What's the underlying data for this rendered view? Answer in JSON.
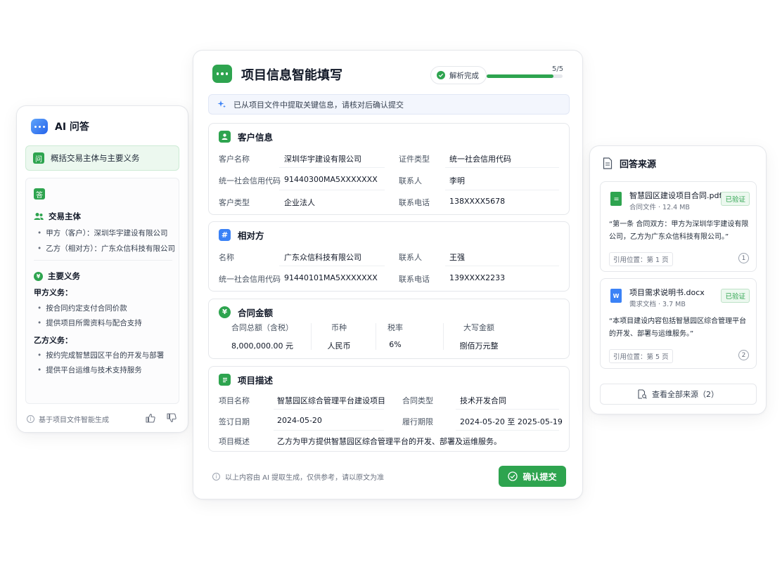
{
  "left": {
    "title": "AI 问答",
    "question_tag": "问",
    "question": "概括交易主体与主要义务",
    "answer_tag": "答",
    "parties_title": "交易主体",
    "parties": [
      "甲方（客户）：深圳华宇建设有限公司",
      "乙方（相对方）：广东众信科技有限公司"
    ],
    "obligations_title": "主要义务",
    "party_a_title": "甲方义务：",
    "party_a_items": [
      "按合同约定支付合同价款",
      "提供项目所需资料与配合支持"
    ],
    "party_b_title": "乙方义务：",
    "party_b_items": [
      "按约完成智慧园区平台的开发与部署",
      "提供平台运维与技术支持服务"
    ],
    "footer": "基于项目文件智能生成"
  },
  "center": {
    "title": "项目信息智能填写",
    "status": "解析完成",
    "progress_text": "5/5",
    "progress_fraction": 0.88,
    "notice": "已从项目文件中提取关键信息，请核对后确认提交",
    "customer": {
      "title": "客户信息",
      "name_label": "客户名称",
      "name_value": "深圳华宇建设有限公司",
      "cert_type_label": "证件类型",
      "cert_type_value": "统一社会信用代码",
      "credit_label": "统一社会信用代码",
      "credit_value": "91440300MA5XXXXXXX",
      "contact_label": "联系人",
      "contact_value": "李明",
      "type_label": "客户类型",
      "type_value": "企业法人",
      "phone_label": "联系电话",
      "phone_value": "138XXXX5678"
    },
    "counterparty": {
      "title": "相对方",
      "name_label": "名称",
      "name_value": "广东众信科技有限公司",
      "contact_label": "联系人",
      "contact_value": "王强",
      "credit_label": "统一社会信用代码",
      "credit_value": "91440101MA5XXXXXXX",
      "phone_label": "联系电话",
      "phone_value": "139XXXX2233"
    },
    "amount": {
      "title": "合同金额",
      "total_label": "合同总额（含税）",
      "total_value": "8,000,000.00 元",
      "currency_label": "币种",
      "currency_value": "人民币",
      "tax_label": "税率",
      "tax_value": "6%",
      "upper_label": "大写金额",
      "upper_value": "捌佰万元整"
    },
    "project": {
      "title": "项目描述",
      "name_label": "项目名称",
      "name_value": "智慧园区综合管理平台建设项目",
      "ctype_label": "合同类型",
      "ctype_value": "技术开发合同",
      "sign_label": "签订日期",
      "sign_value": "2024-05-20",
      "period_label": "履行期限",
      "period_value": "2024-05-20 至 2025-05-19",
      "summary_label": "项目概述",
      "summary_value": "乙方为甲方提供智慧园区综合管理平台的开发、部署及运维服务。"
    },
    "footer_note": "以上内容由 AI 提取生成，仅供参考，请以原文为准",
    "confirm_label": "确认提交"
  },
  "right": {
    "title": "回答来源",
    "sources": [
      {
        "file": "智慧园区建设项目合同.pdf",
        "meta": "合同文件 · 12.4 MB",
        "badge": "已验证",
        "quote": "“第一条  合同双方：甲方为深圳华宇建设有限公司，乙方为广东众信科技有限公司。”",
        "location": "引用位置：第 1 页",
        "index": "1"
      },
      {
        "file": "项目需求说明书.docx",
        "meta": "需求文档 · 3.7 MB",
        "badge": "已验证",
        "quote": "“本项目建设内容包括智慧园区综合管理平台的开发、部署与运维服务。”",
        "location": "引用位置：第 5 页",
        "index": "2"
      }
    ],
    "view_all": "查看全部来源（2）"
  },
  "colors": {
    "accent": "#2ea44f",
    "blue": "#3b82f6"
  }
}
